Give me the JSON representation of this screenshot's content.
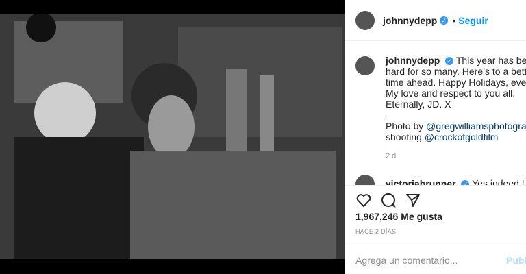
{
  "post": {
    "username": "johnnydepp",
    "follow_label": "Seguir",
    "dot": "•",
    "verified_glyph": "✓",
    "caption_user": "johnnydepp",
    "caption_lines": [
      "This year has been s",
      "hard for so many. Here’s to a better",
      "time ahead. Happy Holidays, everyo",
      "My love and respect to you all.",
      "Eternally, JD. X",
      "-",
      "Photo by ",
      "shooting "
    ],
    "caption_link1": "@gregwilliamsphotograph",
    "caption_link2": "@crockofgoldfilm",
    "age": "2 d",
    "comment_user": "victoriabrunner",
    "comment_text": "Yes indeed !",
    "likes_count": "1,967,246",
    "likes_label": "Me gusta",
    "time_label": "HACE 2 DÍAS",
    "comment_placeholder": "Agrega un comentario...",
    "publish_label": "Publi"
  },
  "icons": [
    "heart-icon",
    "comment-icon",
    "share-icon"
  ],
  "colors": {
    "accent": "#0095f6",
    "verified": "#3897f0",
    "link": "#00376b"
  }
}
